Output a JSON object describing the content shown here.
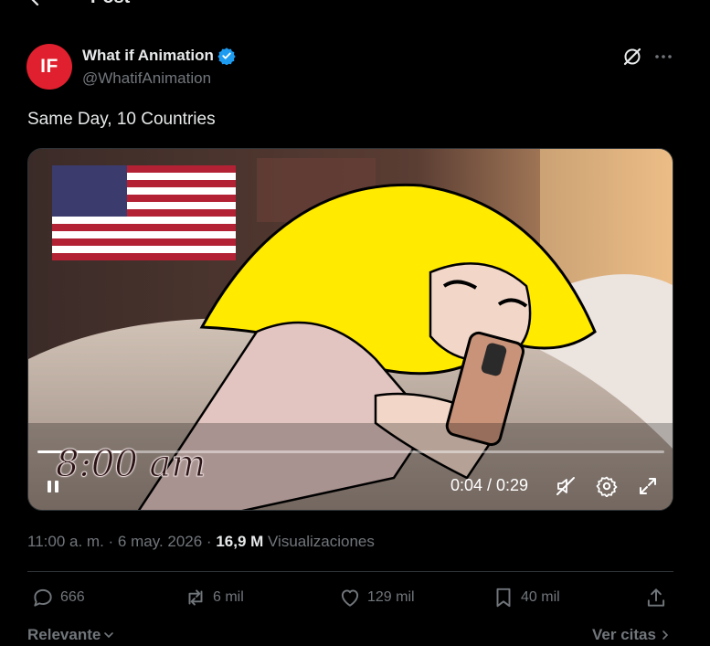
{
  "header": {
    "title": "Post",
    "back_icon": "arrow-left-icon"
  },
  "author": {
    "avatar_text": "IF",
    "avatar_color": "#e0202e",
    "name": "What if Animation",
    "handle": "@WhatifAnimation",
    "verified_color": "#1d9bf0"
  },
  "post": {
    "text": "Same Day, 10 Countries"
  },
  "video": {
    "caption": "8:00 am",
    "time": "0:04 / 0:29",
    "progress": 0.138
  },
  "meta": {
    "time": "11:00 a. m.",
    "sep1": " · ",
    "date": "6 may. 2026",
    "sep2": " · ",
    "views": "16,9 M",
    "views_label": " Visualizaciones"
  },
  "actions": {
    "replies": "666",
    "reposts": "6 mil",
    "likes": "129 mil",
    "bookmarks": "40 mil"
  },
  "replies_section": {
    "sort": "Relevante",
    "quotes": "Ver citas"
  },
  "colors": {
    "background": "#000000",
    "text": "#e7e9ea",
    "muted": "#71767b",
    "border": "#2f3336"
  }
}
